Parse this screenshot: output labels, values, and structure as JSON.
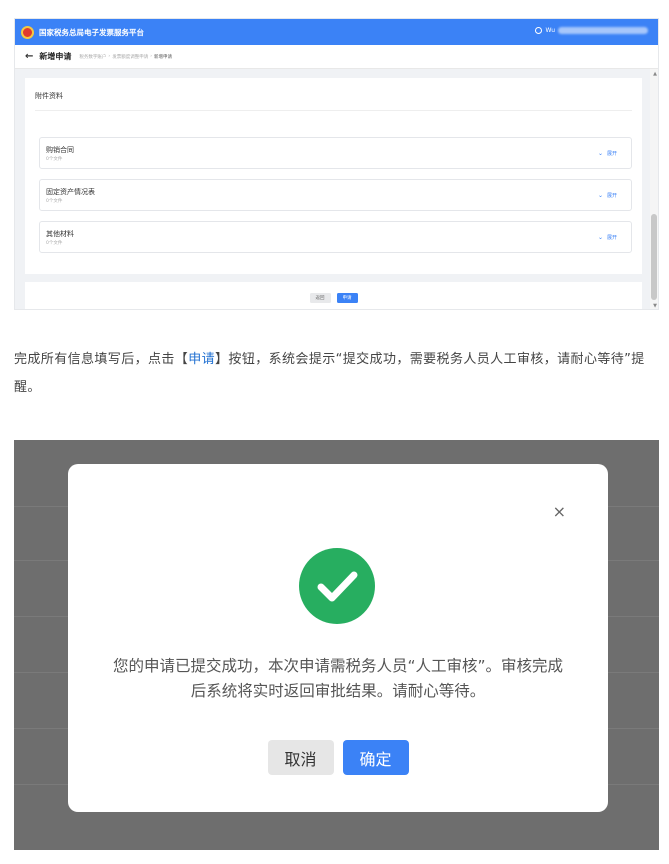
{
  "platform": {
    "title": "国家税务总局电子发票服务平台",
    "user_prefix": "Wu"
  },
  "subheader": {
    "title": "新增申请",
    "breadcrumbs": [
      "税务数字账户",
      "发票额度调整申请",
      "新增申请"
    ]
  },
  "attachments": {
    "section_title": "附件资料",
    "items": [
      {
        "name": "购销合同",
        "count": "0个文件",
        "expand": "展开"
      },
      {
        "name": "固定资产情况表",
        "count": "0个文件",
        "expand": "展开"
      },
      {
        "name": "其他材料",
        "count": "0个文件",
        "expand": "展开"
      }
    ]
  },
  "actions": {
    "back": "返回",
    "apply": "申请"
  },
  "paragraph": {
    "before": "完成所有信息填写后，点击【",
    "highlight": "申请",
    "after": "】按钮，系统会提示“提交成功，需要税务人员人工审核，请耐心等待”提醒。"
  },
  "modal": {
    "message": "您的申请已提交成功，本次申请需税务人员“人工审核”。审核完成后系统将实时返回审批结果。请耐心等待。",
    "cancel": "取消",
    "confirm": "确定",
    "close": "×"
  },
  "colors": {
    "primary": "#3b82f6",
    "success": "#27ae60",
    "overlay": "#6e6e6e",
    "highlight": "#1f6fd1"
  }
}
